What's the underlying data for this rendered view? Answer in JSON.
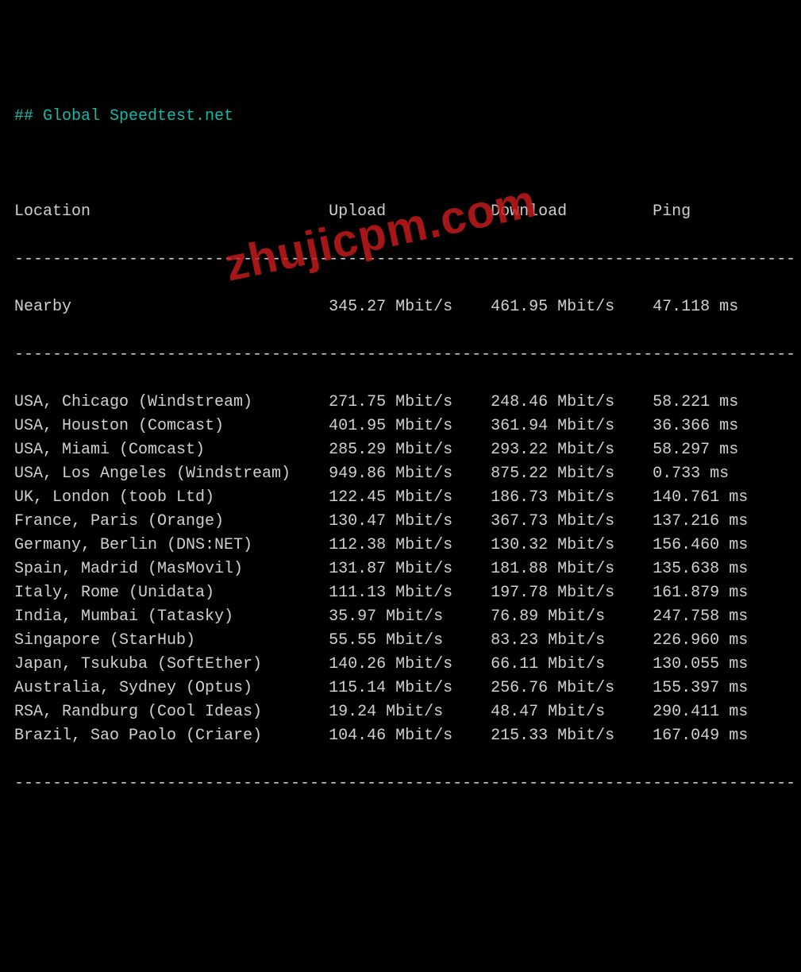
{
  "title_prefix": "## ",
  "title": "Global Speedtest.net",
  "headers": {
    "location": "Location",
    "upload": "Upload",
    "download": "Download",
    "ping": "Ping"
  },
  "nearby": {
    "location": "Nearby",
    "upload": "345.27 Mbit/s",
    "download": "461.95 Mbit/s",
    "ping": "47.118 ms"
  },
  "rows": [
    {
      "location": "USA, Chicago (Windstream)",
      "upload": "271.75 Mbit/s",
      "download": "248.46 Mbit/s",
      "ping": "58.221 ms"
    },
    {
      "location": "USA, Houston (Comcast)",
      "upload": "401.95 Mbit/s",
      "download": "361.94 Mbit/s",
      "ping": "36.366 ms"
    },
    {
      "location": "USA, Miami (Comcast)",
      "upload": "285.29 Mbit/s",
      "download": "293.22 Mbit/s",
      "ping": "58.297 ms"
    },
    {
      "location": "USA, Los Angeles (Windstream)",
      "upload": "949.86 Mbit/s",
      "download": "875.22 Mbit/s",
      "ping": "0.733 ms"
    },
    {
      "location": "UK, London (toob Ltd)",
      "upload": "122.45 Mbit/s",
      "download": "186.73 Mbit/s",
      "ping": "140.761 ms"
    },
    {
      "location": "France, Paris (Orange)",
      "upload": "130.47 Mbit/s",
      "download": "367.73 Mbit/s",
      "ping": "137.216 ms"
    },
    {
      "location": "Germany, Berlin (DNS:NET)",
      "upload": "112.38 Mbit/s",
      "download": "130.32 Mbit/s",
      "ping": "156.460 ms"
    },
    {
      "location": "Spain, Madrid (MasMovil)",
      "upload": "131.87 Mbit/s",
      "download": "181.88 Mbit/s",
      "ping": "135.638 ms"
    },
    {
      "location": "Italy, Rome (Unidata)",
      "upload": "111.13 Mbit/s",
      "download": "197.78 Mbit/s",
      "ping": "161.879 ms"
    },
    {
      "location": "India, Mumbai (Tatasky)",
      "upload": "35.97 Mbit/s",
      "download": "76.89 Mbit/s",
      "ping": "247.758 ms"
    },
    {
      "location": "Singapore (StarHub)",
      "upload": "55.55 Mbit/s",
      "download": "83.23 Mbit/s",
      "ping": "226.960 ms"
    },
    {
      "location": "Japan, Tsukuba (SoftEther)",
      "upload": "140.26 Mbit/s",
      "download": "66.11 Mbit/s",
      "ping": "130.055 ms"
    },
    {
      "location": "Australia, Sydney (Optus)",
      "upload": "115.14 Mbit/s",
      "download": "256.76 Mbit/s",
      "ping": "155.397 ms"
    },
    {
      "location": "RSA, Randburg (Cool Ideas)",
      "upload": "19.24 Mbit/s",
      "download": "48.47 Mbit/s",
      "ping": "290.411 ms"
    },
    {
      "location": "Brazil, Sao Paolo (Criare)",
      "upload": "104.46 Mbit/s",
      "download": "215.33 Mbit/s",
      "ping": "167.049 ms"
    }
  ],
  "watermark": "zhujicpm.com",
  "divider": "----------------------------------------------------------------------------------",
  "chart_data": {
    "type": "table",
    "title": "Global Speedtest.net",
    "columns": [
      "Location",
      "Upload",
      "Download",
      "Ping"
    ],
    "units": {
      "Upload": "Mbit/s",
      "Download": "Mbit/s",
      "Ping": "ms"
    },
    "data": [
      {
        "Location": "Nearby",
        "Upload": 345.27,
        "Download": 461.95,
        "Ping": 47.118
      },
      {
        "Location": "USA, Chicago (Windstream)",
        "Upload": 271.75,
        "Download": 248.46,
        "Ping": 58.221
      },
      {
        "Location": "USA, Houston (Comcast)",
        "Upload": 401.95,
        "Download": 361.94,
        "Ping": 36.366
      },
      {
        "Location": "USA, Miami (Comcast)",
        "Upload": 285.29,
        "Download": 293.22,
        "Ping": 58.297
      },
      {
        "Location": "USA, Los Angeles (Windstream)",
        "Upload": 949.86,
        "Download": 875.22,
        "Ping": 0.733
      },
      {
        "Location": "UK, London (toob Ltd)",
        "Upload": 122.45,
        "Download": 186.73,
        "Ping": 140.761
      },
      {
        "Location": "France, Paris (Orange)",
        "Upload": 130.47,
        "Download": 367.73,
        "Ping": 137.216
      },
      {
        "Location": "Germany, Berlin (DNS:NET)",
        "Upload": 112.38,
        "Download": 130.32,
        "Ping": 156.46
      },
      {
        "Location": "Spain, Madrid (MasMovil)",
        "Upload": 131.87,
        "Download": 181.88,
        "Ping": 135.638
      },
      {
        "Location": "Italy, Rome (Unidata)",
        "Upload": 111.13,
        "Download": 197.78,
        "Ping": 161.879
      },
      {
        "Location": "India, Mumbai (Tatasky)",
        "Upload": 35.97,
        "Download": 76.89,
        "Ping": 247.758
      },
      {
        "Location": "Singapore (StarHub)",
        "Upload": 55.55,
        "Download": 83.23,
        "Ping": 226.96
      },
      {
        "Location": "Japan, Tsukuba (SoftEther)",
        "Upload": 140.26,
        "Download": 66.11,
        "Ping": 130.055
      },
      {
        "Location": "Australia, Sydney (Optus)",
        "Upload": 115.14,
        "Download": 256.76,
        "Ping": 155.397
      },
      {
        "Location": "RSA, Randburg (Cool Ideas)",
        "Upload": 19.24,
        "Download": 48.47,
        "Ping": 290.411
      },
      {
        "Location": "Brazil, Sao Paolo (Criare)",
        "Upload": 104.46,
        "Download": 215.33,
        "Ping": 167.049
      }
    ]
  }
}
